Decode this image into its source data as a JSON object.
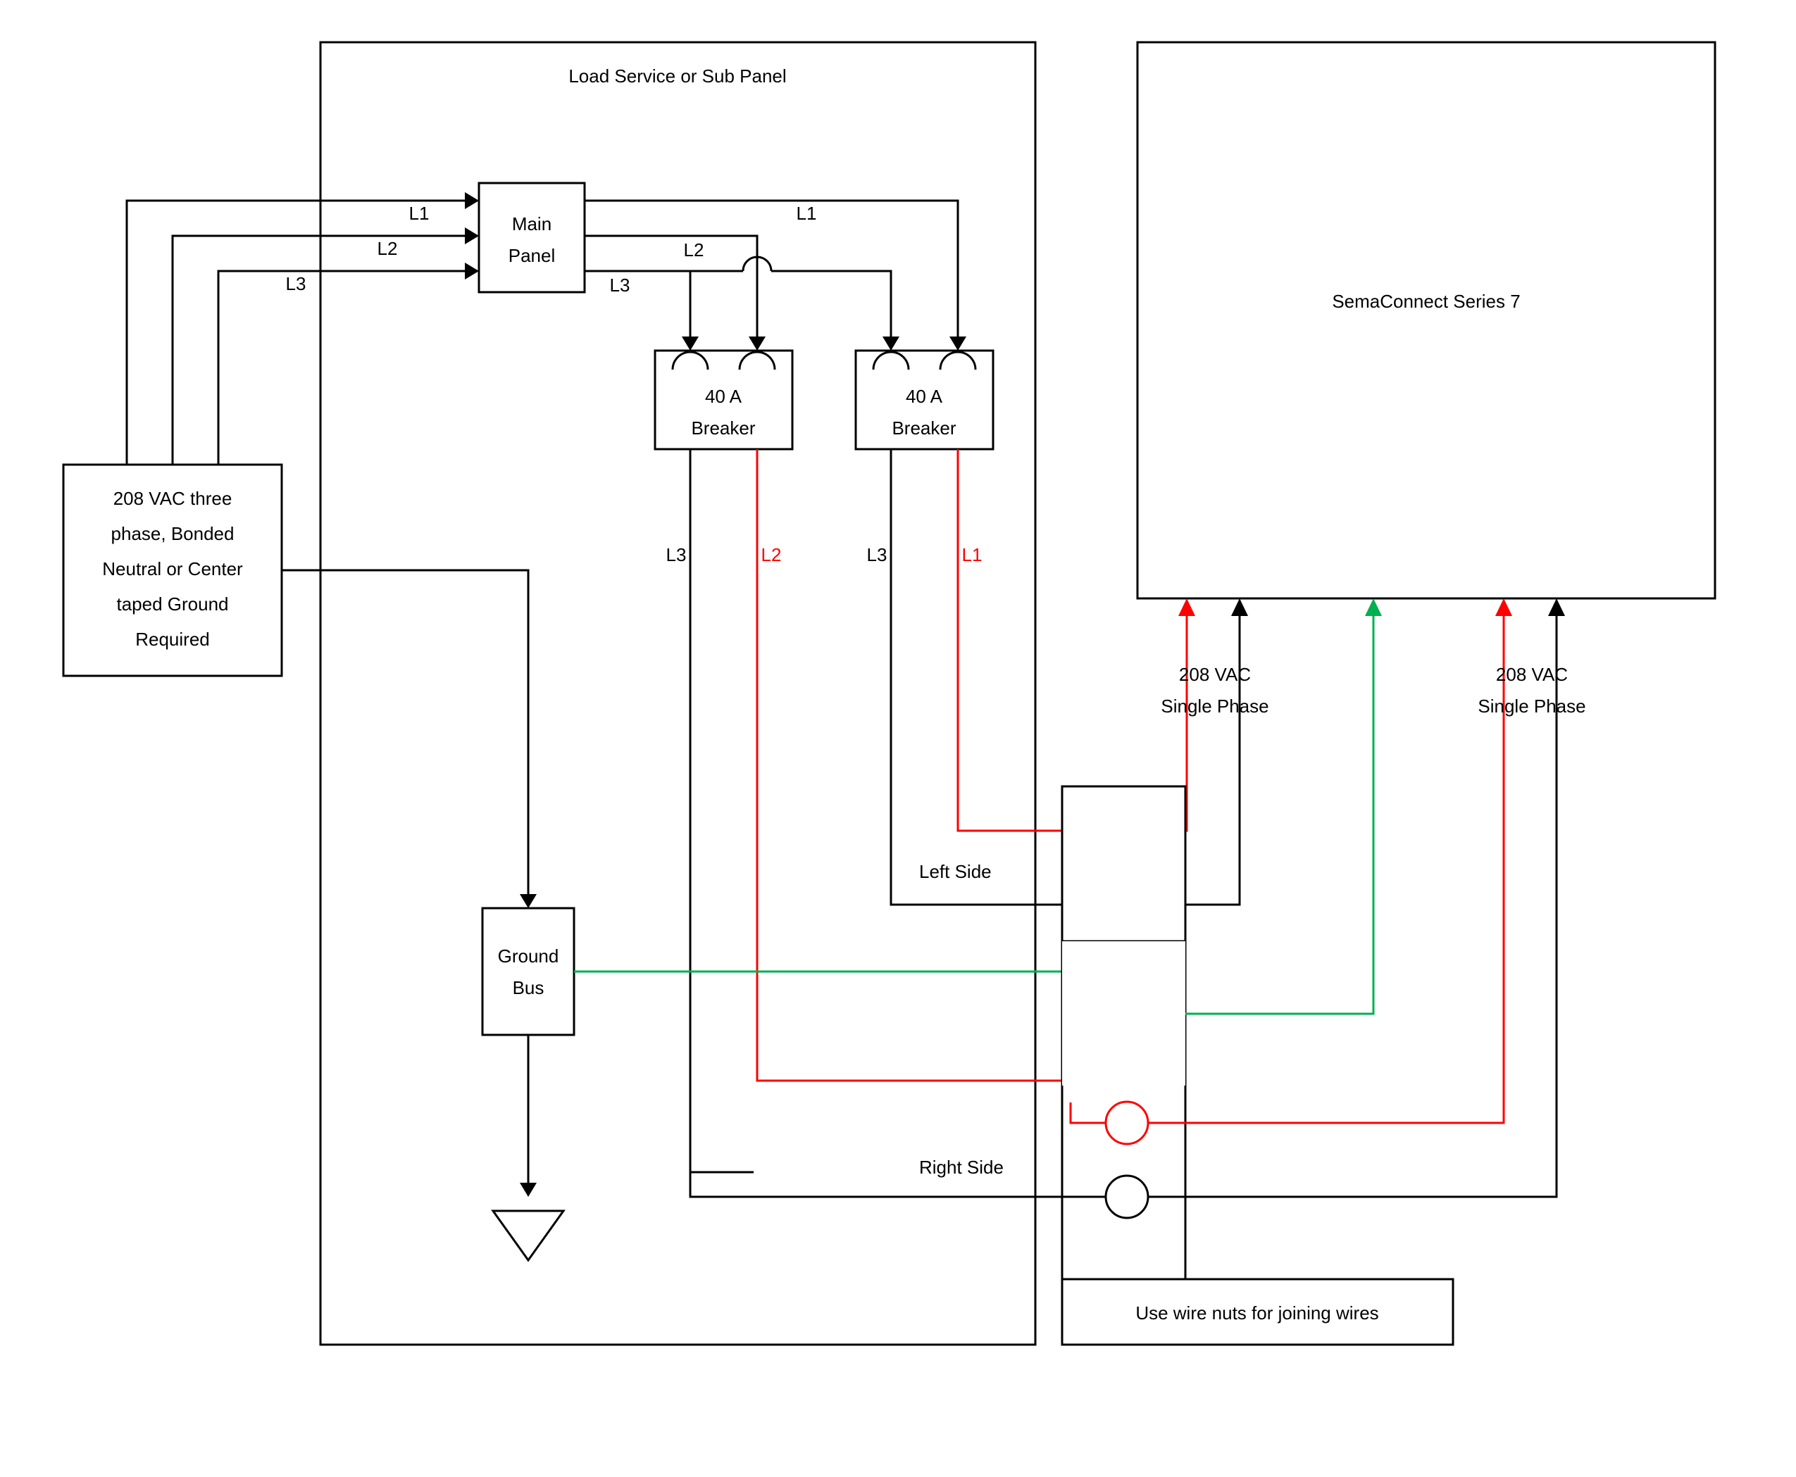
{
  "title": "Load Service or Sub Panel",
  "source_box": {
    "line1": "208 VAC three",
    "line2": "phase, Bonded",
    "line3": "Neutral or Center",
    "line4": "taped Ground",
    "line5": "Required"
  },
  "main_panel": {
    "line1": "Main",
    "line2": "Panel"
  },
  "phase_labels": {
    "L1": "L1",
    "L2": "L2",
    "L3": "L3"
  },
  "breaker1": {
    "line1": "40 A",
    "line2": "Breaker"
  },
  "breaker2": {
    "line1": "40 A",
    "line2": "Breaker"
  },
  "breaker1_out": {
    "left": "L3",
    "right": "L2"
  },
  "breaker2_out": {
    "left": "L3",
    "right": "L1"
  },
  "ground_bus": {
    "line1": "Ground",
    "line2": "Bus"
  },
  "sema": {
    "label": "SemaConnect Series 7"
  },
  "phase_notes": {
    "left": "208 VAC\nSingle Phase",
    "right": "208 VAC\nSingle Phase"
  },
  "sides": {
    "left": "Left Side",
    "right": "Right Side"
  },
  "note_box": "Use wire nuts for joining wires"
}
